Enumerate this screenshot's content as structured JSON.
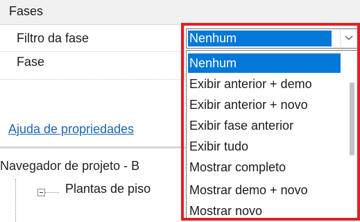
{
  "properties": {
    "section_title": "Fases",
    "rows": [
      {
        "label": "Filtro da fase",
        "value": "Nenhum"
      },
      {
        "label": "Fase",
        "value": ""
      }
    ],
    "help_link": "Ajuda de propriedades"
  },
  "project_browser": {
    "title": "Navegador de projeto - B",
    "tree_item": "Plantas de piso"
  },
  "dropdown": {
    "selected": "Nenhum",
    "options": [
      "Nenhum",
      "Exibir anterior + demo",
      "Exibir anterior + novo",
      "Exibir fase anterior",
      "Exibir tudo",
      "Mostrar completo",
      "Mostrar demo + novo",
      "Mostrar novo"
    ]
  },
  "colors": {
    "selection": "#0078d7",
    "annotation_border": "#e31e24",
    "link": "#1a66b5"
  }
}
